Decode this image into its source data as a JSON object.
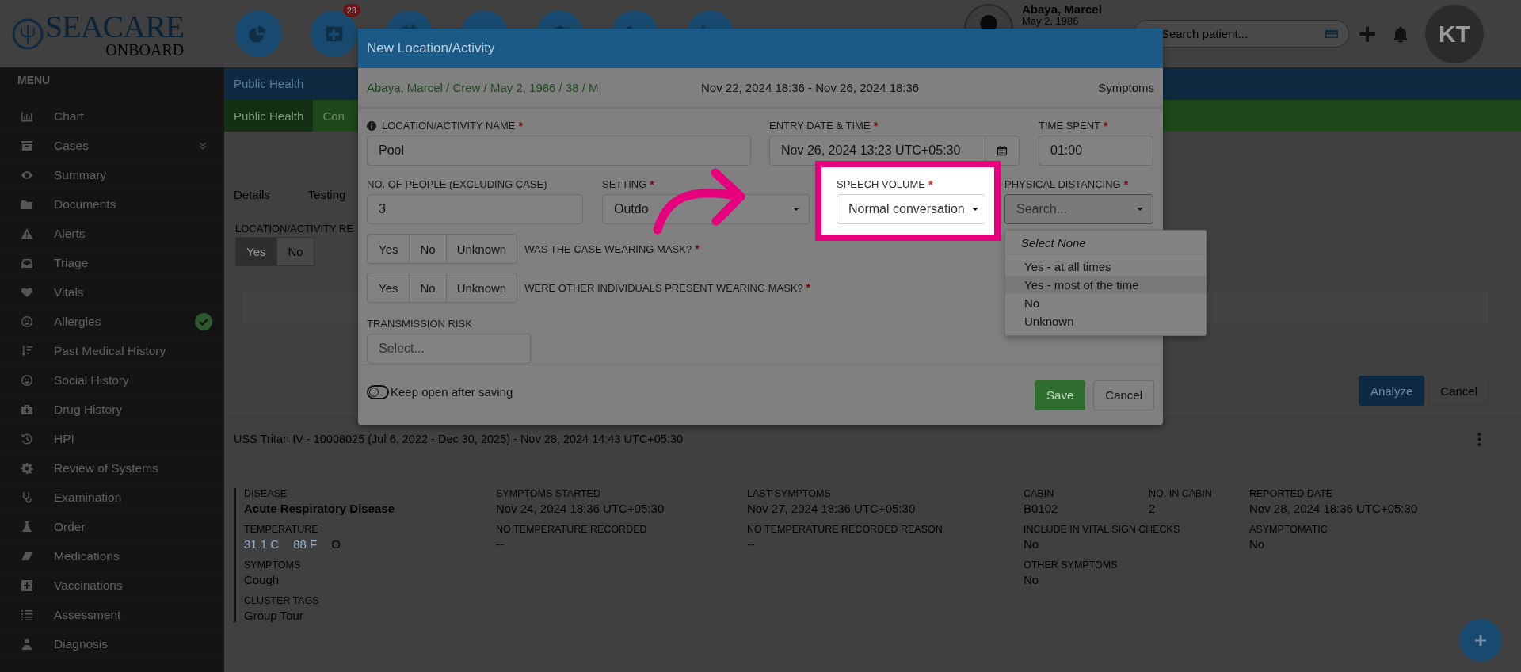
{
  "topbar": {
    "logo_name": "SEACARE",
    "logo_tagline": "ONBOARD",
    "notification_badge": "23",
    "patient_name": "Abaya, Marcel",
    "patient_dob": "May 2, 1986",
    "search": {
      "placeholder": "Search patient..."
    },
    "user_initials": "KT"
  },
  "sidebar": {
    "title": "MENU",
    "items": [
      {
        "label": "Chart",
        "expandable": false,
        "verified": false
      },
      {
        "label": "Cases",
        "expandable": true,
        "verified": false
      },
      {
        "label": "Summary",
        "expandable": false,
        "verified": false
      },
      {
        "label": "Documents",
        "expandable": false,
        "verified": false
      },
      {
        "label": "Alerts",
        "expandable": false,
        "verified": false
      },
      {
        "label": "Triage",
        "expandable": false,
        "verified": false
      },
      {
        "label": "Vitals",
        "expandable": false,
        "verified": false
      },
      {
        "label": "Allergies",
        "expandable": false,
        "verified": true
      },
      {
        "label": "Past Medical History",
        "expandable": false,
        "verified": false
      },
      {
        "label": "Social History",
        "expandable": false,
        "verified": false
      },
      {
        "label": "Drug History",
        "expandable": false,
        "verified": false
      },
      {
        "label": "HPI",
        "expandable": false,
        "verified": false
      },
      {
        "label": "Review of Systems",
        "expandable": false,
        "verified": false
      },
      {
        "label": "Examination",
        "expandable": false,
        "verified": false
      },
      {
        "label": "Order",
        "expandable": false,
        "verified": false
      },
      {
        "label": "Medications",
        "expandable": false,
        "verified": false
      },
      {
        "label": "Vaccinations",
        "expandable": false,
        "verified": false
      },
      {
        "label": "Assessment",
        "expandable": false,
        "verified": false
      },
      {
        "label": "Diagnosis",
        "expandable": false,
        "verified": false
      }
    ]
  },
  "page": {
    "header": "Public Health",
    "tabs": [
      {
        "label": "Public Health",
        "selected": true
      },
      {
        "label": "Con",
        "selected": false
      }
    ],
    "section_tabs": [
      "Details",
      "Testing"
    ],
    "question": "LOCATION/ACTIVITY RE",
    "question_options": [
      {
        "label": "Yes",
        "selected": true
      },
      {
        "label": "No",
        "selected": false
      }
    ],
    "actions": [
      {
        "label": "Analyze",
        "kind": "primary"
      },
      {
        "label": "Cancel",
        "kind": "default"
      }
    ],
    "case": {
      "title": "USS Tritan IV - 10008025 (Jul 6, 2022 - Dec 30, 2025) - Nov 28, 2024 14:43 UTC+05:30",
      "rows": [
        [
          {
            "label": "DISEASE",
            "values": [
              {
                "text": "Acute Respiratory Disease",
                "kind": "strong"
              }
            ]
          },
          {
            "label": "SYMPTOMS STARTED",
            "values": [
              {
                "text": "Nov 24, 2024 18:36 UTC+05:30",
                "kind": "text"
              }
            ]
          },
          {
            "label": "LAST SYMPTOMS",
            "values": [
              {
                "text": "Nov 27, 2024 18:36 UTC+05:30",
                "kind": "text"
              }
            ]
          },
          {
            "label": "CABIN",
            "values": [
              {
                "text": "B0102",
                "kind": "text"
              }
            ]
          },
          {
            "label": "NO. IN CABIN",
            "values": [
              {
                "text": "2",
                "kind": "text"
              }
            ]
          },
          {
            "label": "REPORTED DATE",
            "values": [
              {
                "text": "Nov 28, 2024 18:36 UTC+05:30",
                "kind": "text"
              }
            ]
          }
        ],
        [
          {
            "label": "TEMPERATURE",
            "values": [
              {
                "text": "31.1 C",
                "kind": "link"
              },
              {
                "text": "88 F",
                "kind": "link"
              },
              {
                "text": "O",
                "kind": "text"
              }
            ]
          },
          {
            "label": "NO TEMPERATURE RECORDED",
            "values": [
              {
                "text": "--",
                "kind": "text"
              }
            ]
          },
          {
            "label": "NO TEMPERATURE RECORDED REASON",
            "values": [
              {
                "text": "--",
                "kind": "text"
              }
            ]
          },
          {
            "label": "INCLUDE IN VITAL SIGN CHECKS",
            "values": [
              {
                "text": "No",
                "kind": "text"
              }
            ]
          },
          null,
          {
            "label": "ASYMPTOMATIC",
            "values": [
              {
                "text": "No",
                "kind": "text"
              }
            ]
          }
        ],
        [
          {
            "label": "SYMPTOMS",
            "values": [
              {
                "text": "Cough",
                "kind": "text"
              }
            ]
          },
          null,
          null,
          {
            "label": "OTHER SYMPTOMS",
            "values": [
              {
                "text": "No",
                "kind": "text"
              }
            ]
          },
          null,
          null
        ],
        [
          {
            "label": "CLUSTER TAGS",
            "values": [
              {
                "text": "Group Tour",
                "kind": "text"
              }
            ]
          },
          null,
          null,
          null,
          null,
          null
        ]
      ]
    }
  },
  "modal": {
    "title": "New Location/Activity",
    "patient": "Abaya, Marcel / Crew / May 2, 1986 / 38 / M",
    "period": "Nov 22, 2024 18:36 - Nov 26, 2024 18:36",
    "context": "Symptoms",
    "location_name": {
      "label": "LOCATION/ACTIVITY NAME",
      "required_mark": "*",
      "value": "Pool"
    },
    "entry_date": {
      "label": "ENTRY DATE & TIME",
      "required_mark": "*",
      "value": "Nov 26, 2024 13:23 UTC+05:30"
    },
    "time_spent": {
      "label": "TIME SPENT",
      "required_mark": "*",
      "value": "01:00"
    },
    "people_count": {
      "label": "NO. OF PEOPLE (EXCLUDING CASE)",
      "value": "3"
    },
    "setting": {
      "label": "SETTING",
      "required_mark": "*",
      "value": "Outdo"
    },
    "speech_volume": {
      "label": "SPEECH VOLUME",
      "required_mark": "*",
      "value": "Normal conversation",
      "highlighted": true
    },
    "physical_distancing": {
      "label": "PHYSICAL DISTANCING",
      "required_mark": "*",
      "placeholder": "Search...",
      "expanded": true,
      "clear_option": "Select None",
      "options": [
        {
          "label": "Yes - at all times",
          "hovered": false
        },
        {
          "label": "Yes - most of the time",
          "hovered": true
        },
        {
          "label": "No",
          "hovered": false
        },
        {
          "label": "Unknown",
          "hovered": false
        }
      ]
    },
    "mask_questions": [
      {
        "question": "WAS THE CASE WEARING MASK?",
        "required_mark": "*",
        "options": [
          {
            "label": "Yes",
            "selected": false
          },
          {
            "label": "No",
            "selected": false
          },
          {
            "label": "Unknown",
            "selected": false
          }
        ]
      },
      {
        "question": "WERE OTHER INDIVIDUALS PRESENT WEARING MASK?",
        "required_mark": "*",
        "options": [
          {
            "label": "Yes",
            "selected": false
          },
          {
            "label": "No",
            "selected": false
          },
          {
            "label": "Unknown",
            "selected": false
          }
        ]
      }
    ],
    "transmission_risk": {
      "label": "TRANSMISSION RISK",
      "placeholder": "Select..."
    },
    "keep_open": {
      "label": "Keep open after saving",
      "on": false
    },
    "buttons": [
      {
        "label": "Save",
        "kind": "primary"
      },
      {
        "label": "Cancel",
        "kind": "default"
      }
    ]
  }
}
